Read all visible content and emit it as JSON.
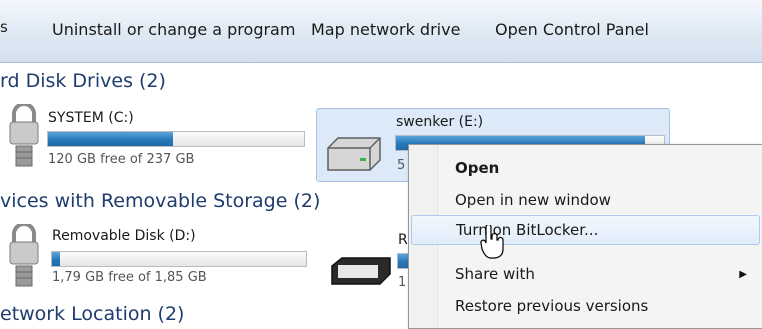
{
  "toolbar": {
    "overflow_marker": "s",
    "uninstall_label": "Uninstall or change a program",
    "map_drive_label": "Map network drive",
    "control_panel_label": "Open Control Panel"
  },
  "sections": {
    "hard_disks_title": "rd Disk Drives (2)",
    "removable_title": "vices with Removable Storage (2)",
    "network_title": "etwork Location (2)"
  },
  "drives": {
    "system": {
      "name": "SYSTEM (C:)",
      "free_text": "120 GB free of 237 GB",
      "used_fraction": 0.49
    },
    "swenker": {
      "name": "swenker (E:)",
      "free_text": "5",
      "used_fraction": 0.93
    },
    "removable": {
      "name": "Removable Disk (D:)",
      "free_text": "1,79 GB free of 1,85 GB",
      "used_fraction": 0.03
    },
    "second_removable": {
      "name": "R",
      "free_text": "1"
    }
  },
  "context_menu": {
    "items": [
      {
        "label": "Open",
        "bold": true
      },
      {
        "label": "Open in new window"
      },
      {
        "label": "Turn on BitLocker...",
        "hovered": true
      },
      {
        "label": "Share with",
        "has_submenu": true
      },
      {
        "label": "Restore previous versions"
      }
    ]
  },
  "colors": {
    "accent": "#2778b9",
    "section_text": "#1e3c6e",
    "selection": "#dce9f8"
  }
}
